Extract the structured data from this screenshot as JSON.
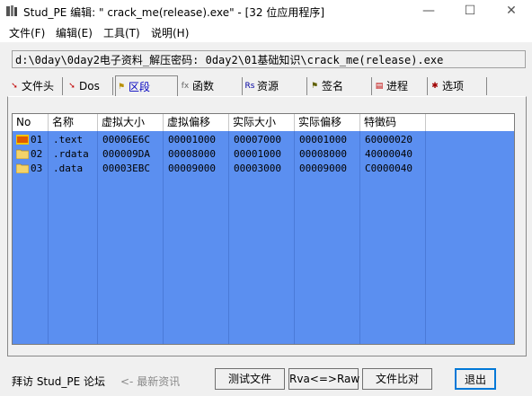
{
  "window": {
    "title": "Stud_PE 编辑: \"    crack_me(release).exe\" - [32 位应用程序]",
    "minimize": "—",
    "maximize": "☐",
    "close": "✕"
  },
  "menu": [
    "文件(F)",
    "编辑(E)",
    "工具(T)",
    "说明(H)"
  ],
  "path": "d:\\0day\\0day2电子资料_解压密码: 0day2\\01基础知识\\crack_me(release).exe",
  "tabs": [
    {
      "label": "文件头",
      "icon": "arrow-icon",
      "active": false
    },
    {
      "label": "Dos",
      "icon": "arrow-icon",
      "active": false
    },
    {
      "label": "区段",
      "icon": "flag-icon",
      "active": true
    },
    {
      "label": "函数",
      "icon": "fx-icon",
      "active": false
    },
    {
      "label": "资源",
      "icon": "rs-icon",
      "active": false
    },
    {
      "label": "签名",
      "icon": "flag-icon",
      "active": false
    },
    {
      "label": "进程",
      "icon": "process-icon",
      "active": false
    },
    {
      "label": "选项",
      "icon": "options-icon",
      "active": false
    }
  ],
  "table": {
    "headers": [
      "No",
      "名称",
      "虚拟大小",
      "虚拟偏移",
      "实际大小",
      "实际偏移",
      "特徵码"
    ],
    "rows": [
      {
        "no": "01",
        "name": ".text",
        "vsize": "00006E6C",
        "voff": "00001000",
        "rsize": "00007000",
        "roff": "00001000",
        "chars": "60000020",
        "icon": "ep-icon"
      },
      {
        "no": "02",
        "name": ".rdata",
        "vsize": "000009DA",
        "voff": "00008000",
        "rsize": "00001000",
        "roff": "00008000",
        "chars": "40000040",
        "icon": "folder-icon"
      },
      {
        "no": "03",
        "name": ".data",
        "vsize": "00003EBC",
        "voff": "00009000",
        "rsize": "00003000",
        "roff": "00009000",
        "chars": "C0000040",
        "icon": "folder-icon"
      }
    ]
  },
  "footer": {
    "visit": "拜访 Stud_PE 论坛",
    "news": "<- 最新资讯",
    "test_file": "测试文件",
    "rva": "Rva<=>Raw",
    "compare": "文件比对",
    "exit": "退出"
  }
}
